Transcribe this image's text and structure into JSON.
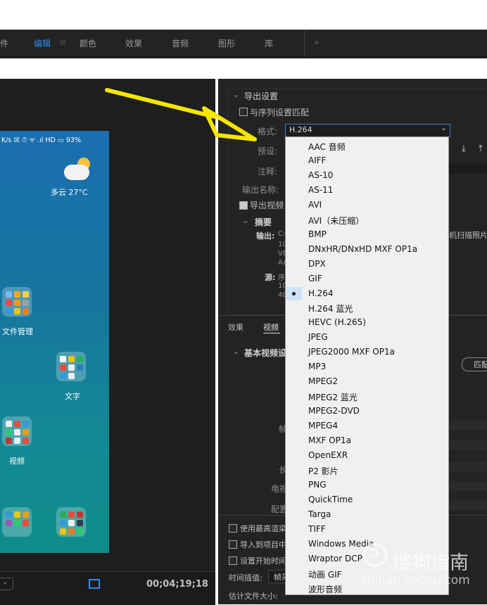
{
  "workspace_tabs": [
    {
      "label": "件"
    },
    {
      "label": "编辑"
    },
    {
      "label": "≡"
    },
    {
      "label": "颜色"
    },
    {
      "label": "效果"
    },
    {
      "label": "音频"
    },
    {
      "label": "图形"
    },
    {
      "label": "库"
    },
    {
      "label": "»"
    }
  ],
  "phone": {
    "statusbar": "K/s ☒ ⏱ ᯤ .ıl HD ▭ 93%",
    "weather": "多云  27°C",
    "apps": [
      "文件管理",
      "文字",
      "视频"
    ]
  },
  "monitor": {
    "timecode": "00;04;19;18"
  },
  "export": {
    "section_title": "导出设置",
    "match_sequence": "与序列设置匹配",
    "format_label": "格式:",
    "format_value": "H.264",
    "preset_label": "预设:",
    "comment_label": "注释:",
    "output_name_label": "输出名称:",
    "export_video": "导出视频",
    "summary_title": "摘要",
    "output_label": "输出:",
    "output_value": "C:",
    "output_lines": [
      "10",
      "VE",
      "AA"
    ],
    "output_tail": "机扫描照片",
    "source_label": "源:",
    "source_value": "序",
    "source_lines": [
      "10",
      "48"
    ]
  },
  "settings_tabs": [
    {
      "label": "效果"
    },
    {
      "label": "视频"
    }
  ],
  "basic_video": "基本视频设",
  "match_button": "匹配",
  "side_labels": [
    "帧",
    "长",
    "电视",
    "配置"
  ],
  "bottom_options": {
    "max_render": "使用最高渲染",
    "import_project": "导入到项目中",
    "set_start": "设置开始时间",
    "interp_label": "时间插值:",
    "interp_value": "帧采",
    "est_size": "估计文件大小:"
  },
  "dropdown": {
    "selected": "H.264",
    "options": [
      "AAC 音频",
      "AIFF",
      "AS-10",
      "AS-11",
      "AVI",
      "AVI（未压缩）",
      "BMP",
      "DNxHR/DNxHD MXF OP1a",
      "DPX",
      "GIF",
      "H.264",
      "H.264 蓝光",
      "HEVC (H.265)",
      "JPEG",
      "JPEG2000 MXF OP1a",
      "MP3",
      "MPEG2",
      "MPEG2 蓝光",
      "MPEG2-DVD",
      "MPEG4",
      "MXF OP1a",
      "OpenEXR",
      "P2 影片",
      "PNG",
      "QuickTime",
      "Targa",
      "TIFF",
      "Windows Media",
      "Wraptor DCP",
      "动画 GIF",
      "波形音频"
    ]
  },
  "watermark": {
    "text": "搜狗指南",
    "url": "zhinan.sogou.com"
  },
  "colors": {
    "accent": "#2d8ceb",
    "arrow": "#f5e600",
    "panel": "#232323"
  }
}
